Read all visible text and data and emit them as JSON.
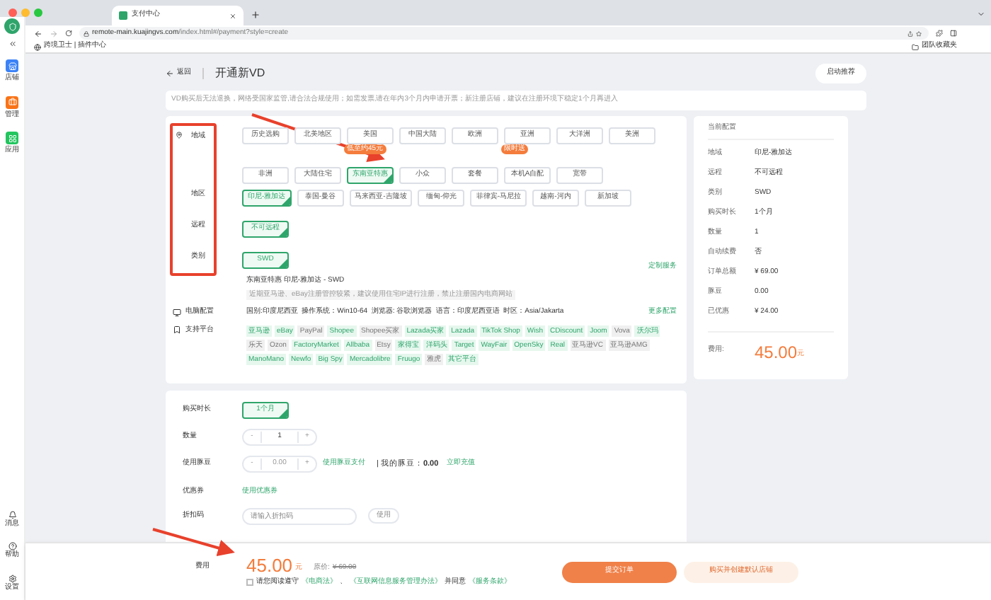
{
  "browser": {
    "tab_title": "支付中心",
    "url_host": "remote-main.kuajingvs.com",
    "url_path": "/index.html#/payment?style=create",
    "bookmark": "跨境卫士 | 插件中心",
    "bookmark_right": "团队收藏夹"
  },
  "sidebar": {
    "top": [
      "店铺",
      "管理",
      "应用"
    ],
    "bottom": [
      "消息",
      "帮助",
      "设置"
    ]
  },
  "header": {
    "back": "返回",
    "title": "开通新VD",
    "recommend": "启动推荐"
  },
  "notice": "VD购买后无法退换，网络受国家监管,请合法合规使用；如需发票,请在年内3个月内申请开票；新注册店铺，建议在注册环境下稳定1个月再进入",
  "config": {
    "groups": [
      {
        "label": "地域",
        "options": [
          {
            "text": "历史选购",
            "selected": false
          },
          {
            "text": "北美地区",
            "selected": false
          },
          {
            "text": "美国",
            "selected": false
          },
          {
            "text": "中国大陆",
            "selected": false
          },
          {
            "text": "欧洲",
            "selected": false
          },
          {
            "text": "亚洲",
            "selected": false
          },
          {
            "text": "大洋洲",
            "selected": false
          },
          {
            "text": "美洲",
            "selected": false
          },
          {
            "text": "非洲",
            "selected": false
          },
          {
            "text": "大陆住宅",
            "selected": false
          },
          {
            "text": "东南亚特惠",
            "selected": true,
            "badge": "低至约45元"
          },
          {
            "text": "小众",
            "selected": false
          },
          {
            "text": "套餐",
            "selected": false
          },
          {
            "text": "本机A自配",
            "selected": false,
            "badge": "限时送"
          },
          {
            "text": "宽带",
            "selected": false
          }
        ]
      },
      {
        "label": "地区",
        "options": [
          {
            "text": "印尼-雅加达",
            "selected": true
          },
          {
            "text": "泰国-曼谷",
            "selected": false
          },
          {
            "text": "马来西亚-吉隆坡",
            "selected": false
          },
          {
            "text": "缅甸-仰光",
            "selected": false
          },
          {
            "text": "菲律宾-马尼拉",
            "selected": false
          },
          {
            "text": "越南-河内",
            "selected": false
          },
          {
            "text": "新加坡",
            "selected": false
          }
        ]
      },
      {
        "label": "远程",
        "options": [
          {
            "text": "不可远程",
            "selected": true
          }
        ]
      },
      {
        "label": "类别",
        "options": [
          {
            "text": "SWD",
            "selected": true
          }
        ]
      }
    ],
    "summary": "东南亚特惠 印尼-雅加达 - SWD",
    "custom_link": "定制服务",
    "hint": "近期亚马逊、eBay注册管控较紧，建议使用住宅IP进行注册，禁止注册国内电商网站",
    "pc_label": "电脑配置",
    "pc_text": "国别:印度尼西亚  操作系统：Win10-64  浏览器: 谷歌浏览器  语言：印度尼西亚语  时区：Asia/Jakarta",
    "pc_link": "更多配置",
    "platform_label": "支持平台",
    "platforms": [
      {
        "text": "亚马逊",
        "enabled": true
      },
      {
        "text": "eBay",
        "enabled": true
      },
      {
        "text": "PayPal",
        "enabled": false
      },
      {
        "text": "Shopee",
        "enabled": true
      },
      {
        "text": "Shopee买家",
        "enabled": false
      },
      {
        "text": "Lazada买家",
        "enabled": true
      },
      {
        "text": "Lazada",
        "enabled": true
      },
      {
        "text": "TikTok Shop",
        "enabled": true
      },
      {
        "text": "Wish",
        "enabled": true
      },
      {
        "text": "CDiscount",
        "enabled": true
      },
      {
        "text": "Joom",
        "enabled": true
      },
      {
        "text": "Vova",
        "enabled": false
      },
      {
        "text": "沃尔玛",
        "enabled": true
      },
      {
        "text": "乐天",
        "enabled": false
      },
      {
        "text": "Ozon",
        "enabled": false
      },
      {
        "text": "FactoryMarket",
        "enabled": true
      },
      {
        "text": "Allbaba",
        "enabled": true
      },
      {
        "text": "Etsy",
        "enabled": false
      },
      {
        "text": "家得宝",
        "enabled": true
      },
      {
        "text": "洋码头",
        "enabled": true
      },
      {
        "text": "Target",
        "enabled": true
      },
      {
        "text": "WayFair",
        "enabled": true
      },
      {
        "text": "OpenSky",
        "enabled": true
      },
      {
        "text": "Real",
        "enabled": true
      },
      {
        "text": "亚马逊VC",
        "enabled": false
      },
      {
        "text": "亚马逊AMG",
        "enabled": false
      },
      {
        "text": "ManoMano",
        "enabled": true
      },
      {
        "text": "Newfo",
        "enabled": true
      },
      {
        "text": "Big Spy",
        "enabled": true
      },
      {
        "text": "Mercadolibre",
        "enabled": true
      },
      {
        "text": "Fruugo",
        "enabled": true
      },
      {
        "text": "雅虎",
        "enabled": false
      },
      {
        "text": "其它平台",
        "enabled": true
      }
    ]
  },
  "purchase": {
    "duration_label": "购买时长",
    "duration": {
      "text": "1个月",
      "selected": true
    },
    "qty_label": "数量",
    "qty": "1",
    "minus": "-",
    "plus": "+",
    "beans_label": "使用豚豆",
    "beans": "0.00",
    "beans_pay": "使用豚豆支付",
    "my_beans_label": "| 我的豚豆：",
    "my_beans": "0.00",
    "recharge": "立即充值",
    "coupon_label": "优惠券",
    "coupon_link": "使用优惠券",
    "discount_label": "折扣码",
    "discount_placeholder": "请输入折扣码",
    "discount_button": "使用"
  },
  "summary_panel": {
    "title": "当前配置",
    "rows": [
      {
        "label": "地域",
        "value": "印尼-雅加达"
      },
      {
        "label": "远程",
        "value": "不可远程"
      },
      {
        "label": "类别",
        "value": "SWD"
      },
      {
        "label": "购买时长",
        "value": "1个月"
      },
      {
        "label": "数量",
        "value": "1"
      },
      {
        "label": "自动续费",
        "value": "否"
      },
      {
        "label": "订单总额",
        "value": "¥ 69.00"
      },
      {
        "label": "豚豆",
        "value": "0.00"
      },
      {
        "label": "已优惠",
        "value": "¥ 24.00"
      }
    ],
    "fee_label": "费用:",
    "fee": "45.00",
    "unit": "元"
  },
  "footer": {
    "fee_label": "费用",
    "fee": "45.00",
    "unit": "元",
    "original_label": "原价:",
    "original": "¥ 69.00",
    "agree_checked": false,
    "agree_text": "请您阅读遵守",
    "law1": "《电商法》",
    "sep": "、",
    "law2": "《互联网信息服务管理办法》",
    "and": "并同意",
    "terms": "《服务条款》",
    "submit": "提交订单",
    "buy_create": "购买并创建默认店铺"
  }
}
